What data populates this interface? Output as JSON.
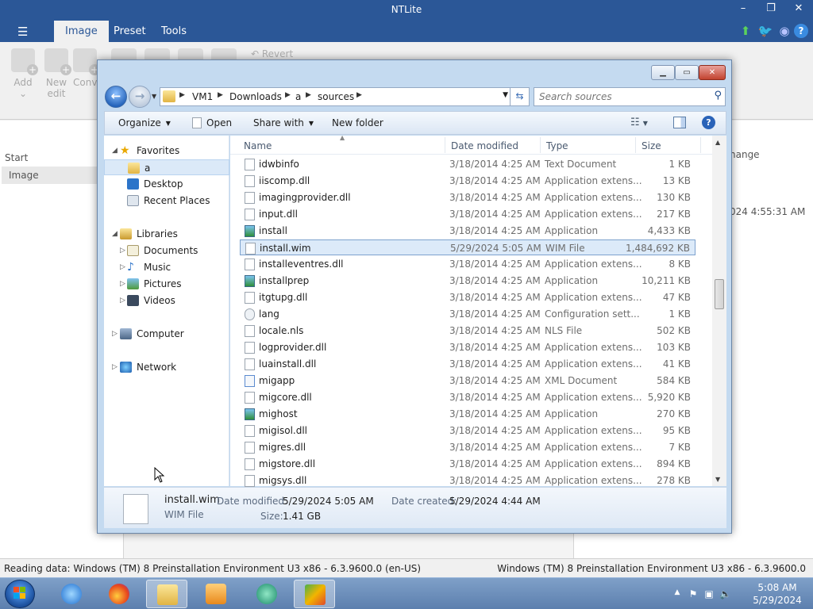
{
  "app": {
    "title": "NTLite",
    "tabs": [
      {
        "label": "Image"
      },
      {
        "label": "Preset"
      },
      {
        "label": "Tools"
      }
    ],
    "ribbon": {
      "add_label": "Add",
      "add_sub": "⌄",
      "new_label": "New",
      "new_sub": "edit",
      "conv_label": "Conv",
      "revert_label": "Revert"
    },
    "left_panel": {
      "start_label": "Start",
      "image_label": "Image"
    },
    "right_panel": {
      "change_fragment": "hange",
      "date_fragment": "024 4:55:31 AM"
    },
    "status": {
      "left": "Reading data: Windows (TM) 8 Preinstallation Environment U3 x86 - 6.3.9600.0 (en-US)",
      "right": "Windows (TM) 8 Preinstallation Environment U3 x86 - 6.3.9600.0"
    },
    "colors": {
      "accent": "#2b5797",
      "selection": "#dceaf9"
    }
  },
  "dialog": {
    "breadcrumb": [
      "VM1",
      "Downloads",
      "a",
      "sources"
    ],
    "search_placeholder": "Search sources",
    "commands": {
      "organize": "Organize",
      "open": "Open",
      "share_with": "Share with",
      "new_folder": "New folder"
    },
    "nav": {
      "favorites": "Favorites",
      "fav_items": [
        "a",
        "Desktop",
        "Recent Places"
      ],
      "libraries": "Libraries",
      "lib_items": [
        "Documents",
        "Music",
        "Pictures",
        "Videos"
      ],
      "computer": "Computer",
      "network": "Network"
    },
    "columns": {
      "name": "Name",
      "date": "Date modified",
      "type": "Type",
      "size": "Size"
    },
    "files": [
      {
        "name": "idwbinfo",
        "date": "3/18/2014 4:25 AM",
        "type": "Text Document",
        "size": "1 KB",
        "icon": "doc"
      },
      {
        "name": "iiscomp.dll",
        "date": "3/18/2014 4:25 AM",
        "type": "Application extens...",
        "size": "13 KB",
        "icon": "dll"
      },
      {
        "name": "imagingprovider.dll",
        "date": "3/18/2014 4:25 AM",
        "type": "Application extens...",
        "size": "130 KB",
        "icon": "dll"
      },
      {
        "name": "input.dll",
        "date": "3/18/2014 4:25 AM",
        "type": "Application extens...",
        "size": "217 KB",
        "icon": "dll"
      },
      {
        "name": "install",
        "date": "3/18/2014 4:25 AM",
        "type": "Application",
        "size": "4,433 KB",
        "icon": "app"
      },
      {
        "name": "install.wim",
        "date": "5/29/2024 5:05 AM",
        "type": "WIM File",
        "size": "1,484,692 KB",
        "icon": "doc"
      },
      {
        "name": "installeventres.dll",
        "date": "3/18/2014 4:25 AM",
        "type": "Application extens...",
        "size": "8 KB",
        "icon": "dll"
      },
      {
        "name": "installprep",
        "date": "3/18/2014 4:25 AM",
        "type": "Application",
        "size": "10,211 KB",
        "icon": "app"
      },
      {
        "name": "itgtupg.dll",
        "date": "3/18/2014 4:25 AM",
        "type": "Application extens...",
        "size": "47 KB",
        "icon": "dll"
      },
      {
        "name": "lang",
        "date": "3/18/2014 4:25 AM",
        "type": "Configuration sett...",
        "size": "1 KB",
        "icon": "cfg"
      },
      {
        "name": "locale.nls",
        "date": "3/18/2014 4:25 AM",
        "type": "NLS File",
        "size": "502 KB",
        "icon": "doc"
      },
      {
        "name": "logprovider.dll",
        "date": "3/18/2014 4:25 AM",
        "type": "Application extens...",
        "size": "103 KB",
        "icon": "dll"
      },
      {
        "name": "luainstall.dll",
        "date": "3/18/2014 4:25 AM",
        "type": "Application extens...",
        "size": "41 KB",
        "icon": "dll"
      },
      {
        "name": "migapp",
        "date": "3/18/2014 4:25 AM",
        "type": "XML Document",
        "size": "584 KB",
        "icon": "xml"
      },
      {
        "name": "migcore.dll",
        "date": "3/18/2014 4:25 AM",
        "type": "Application extens...",
        "size": "5,920 KB",
        "icon": "dll"
      },
      {
        "name": "mighost",
        "date": "3/18/2014 4:25 AM",
        "type": "Application",
        "size": "270 KB",
        "icon": "app"
      },
      {
        "name": "migisol.dll",
        "date": "3/18/2014 4:25 AM",
        "type": "Application extens...",
        "size": "95 KB",
        "icon": "dll"
      },
      {
        "name": "migres.dll",
        "date": "3/18/2014 4:25 AM",
        "type": "Application extens...",
        "size": "7 KB",
        "icon": "dll"
      },
      {
        "name": "migstore.dll",
        "date": "3/18/2014 4:25 AM",
        "type": "Application extens...",
        "size": "894 KB",
        "icon": "dll"
      },
      {
        "name": "migsys.dll",
        "date": "3/18/2014 4:25 AM",
        "type": "Application extens...",
        "size": "278 KB",
        "icon": "dll"
      }
    ],
    "selected_index": 5,
    "details": {
      "name": "install.wim",
      "type": "WIM File",
      "date_modified_label": "Date modified:",
      "date_modified": "5/29/2024 5:05 AM",
      "date_created_label": "Date created:",
      "date_created": "5/29/2024 4:44 AM",
      "size_label": "Size:",
      "size": "1.41 GB"
    }
  },
  "taskbar": {
    "time": "5:08 AM",
    "date": "5/29/2024"
  }
}
